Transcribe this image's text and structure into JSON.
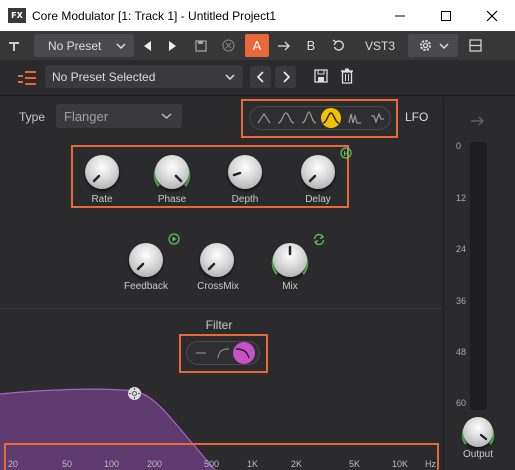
{
  "window": {
    "title": "Core Modulator [1: Track 1] - Untitled Project1",
    "app_icon": "FX"
  },
  "host": {
    "preset": "No Preset",
    "ab_a": "A",
    "ab_b": "B",
    "format": "VST3"
  },
  "plugin": {
    "preset": "No Preset Selected"
  },
  "type": {
    "label": "Type",
    "value": "Flanger"
  },
  "lfo": {
    "label": "LFO",
    "shapes": [
      "triangle",
      "bump",
      "peak",
      "sine-selected",
      "double-peak",
      "random"
    ]
  },
  "knobs": {
    "rate": "Rate",
    "phase": "Phase",
    "depth": "Depth",
    "delay": "Delay",
    "feedback": "Feedback",
    "crossmix": "CrossMix",
    "mix": "Mix"
  },
  "filter": {
    "label": "Filter"
  },
  "output": {
    "label": "Output",
    "scale": [
      "0",
      "12",
      "24",
      "36",
      "48",
      "60"
    ]
  },
  "freq_axis": [
    "20",
    "50",
    "100",
    "200",
    "500",
    "1K",
    "2K",
    "5K",
    "10K",
    "Hz"
  ],
  "colors": {
    "accent_orange": "#e8683a",
    "green": "#5ac85a",
    "yellow": "#f2c200",
    "magenta": "#c850c8",
    "purple_fill": "#5e3a6e"
  }
}
